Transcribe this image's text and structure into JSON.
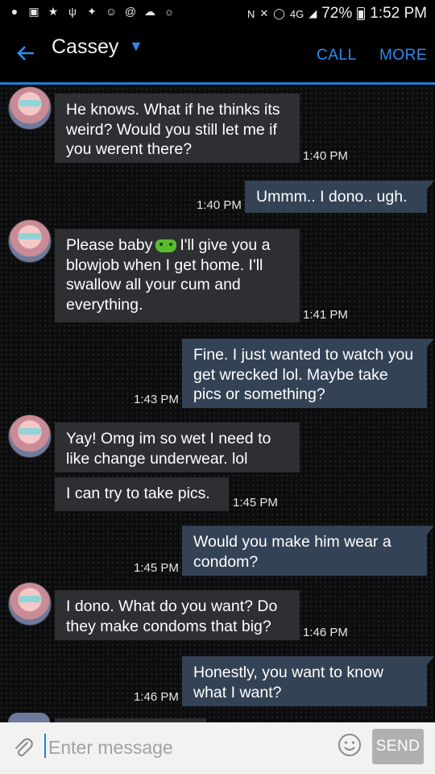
{
  "status": {
    "battery": "72%",
    "time": "1:52 PM",
    "network": "4G"
  },
  "header": {
    "contact": "Cassey",
    "call": "CALL",
    "more": "MORE"
  },
  "messages": [
    {
      "dir": "in",
      "text": "He knows. What if he thinks its weird? Would you still let me if you werent there?",
      "time": "1:40 PM"
    },
    {
      "dir": "out",
      "text": "Ummm.. I dono.. ugh.",
      "time": "1:40 PM"
    },
    {
      "dir": "in",
      "text_before": "Please baby",
      "emoji": "android-emoji",
      "text_after": "I'll give you a blowjob when I get home. I'll swallow all your cum and everything.",
      "time": "1:41 PM"
    },
    {
      "dir": "out",
      "text": "Fine. I just wanted to watch you get wrecked lol. Maybe take pics or something?",
      "time": "1:43 PM"
    },
    {
      "dir": "in",
      "text": "Yay! Omg im so wet I need to like change underwear. lol"
    },
    {
      "dir": "in",
      "text": "I can try to take pics.",
      "time": "1:45 PM"
    },
    {
      "dir": "out",
      "text": "Would you make him wear a condom?",
      "time": "1:45 PM"
    },
    {
      "dir": "in",
      "text": "I dono. What do you want? Do they make condoms that big?",
      "time": "1:46 PM"
    },
    {
      "dir": "out",
      "text": "Honestly, you want to know what I want?",
      "time": "1:46 PM"
    }
  ],
  "composer": {
    "placeholder": "Enter message",
    "send": "SEND"
  },
  "colors": {
    "accent": "#1f7fd6",
    "incoming_bubble": "#2d2f33",
    "outgoing_bubble": "#344255"
  }
}
